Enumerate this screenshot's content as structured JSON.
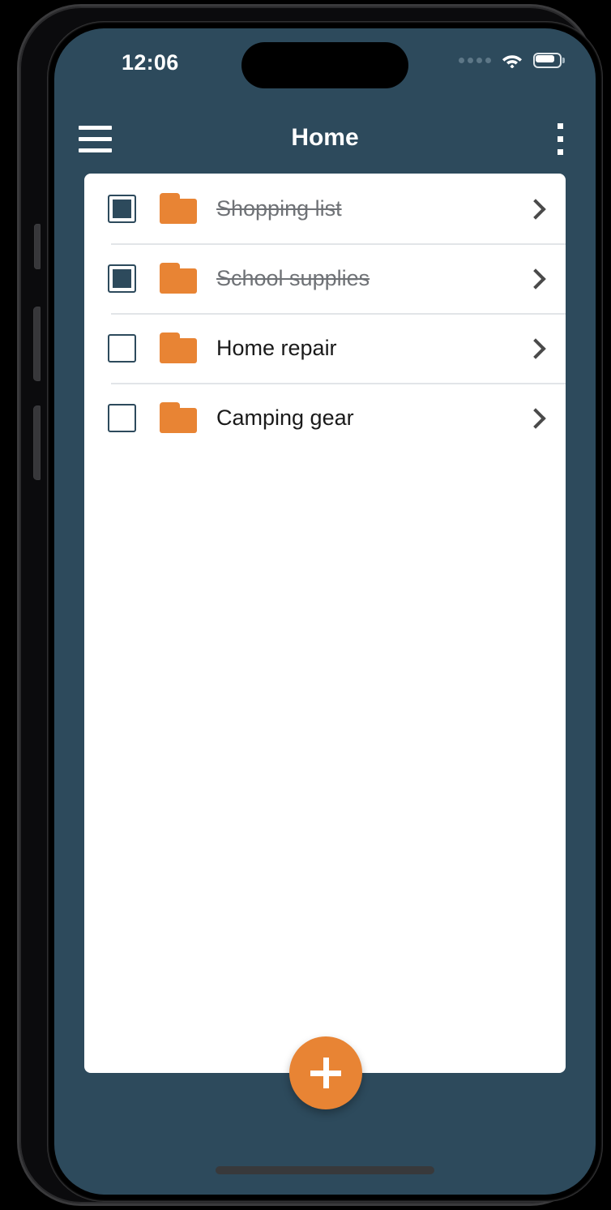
{
  "status_bar": {
    "time": "12:06",
    "signal_icon": "signal-dots-icon",
    "wifi_icon": "wifi-icon",
    "battery_icon": "battery-icon"
  },
  "app_bar": {
    "menu_icon": "hamburger-menu-icon",
    "title": "Home",
    "overflow_icon": "more-vertical-icon"
  },
  "list": {
    "items": [
      {
        "label": "Shopping list",
        "checked": true,
        "folder_icon": "folder-icon",
        "chevron_icon": "chevron-right-icon"
      },
      {
        "label": "School supplies",
        "checked": true,
        "folder_icon": "folder-icon",
        "chevron_icon": "chevron-right-icon"
      },
      {
        "label": "Home repair",
        "checked": false,
        "folder_icon": "folder-icon",
        "chevron_icon": "chevron-right-icon"
      },
      {
        "label": "Camping gear",
        "checked": false,
        "folder_icon": "folder-icon",
        "chevron_icon": "chevron-right-icon"
      }
    ]
  },
  "fab": {
    "icon": "plus-icon",
    "label": "+"
  },
  "colors": {
    "background": "#2d4a5c",
    "accent": "#e88434",
    "card": "#ffffff",
    "divider": "#e2e5e8",
    "text_primary": "#1a1a1a",
    "text_done": "#6f7276",
    "status_text": "#ffffff"
  }
}
